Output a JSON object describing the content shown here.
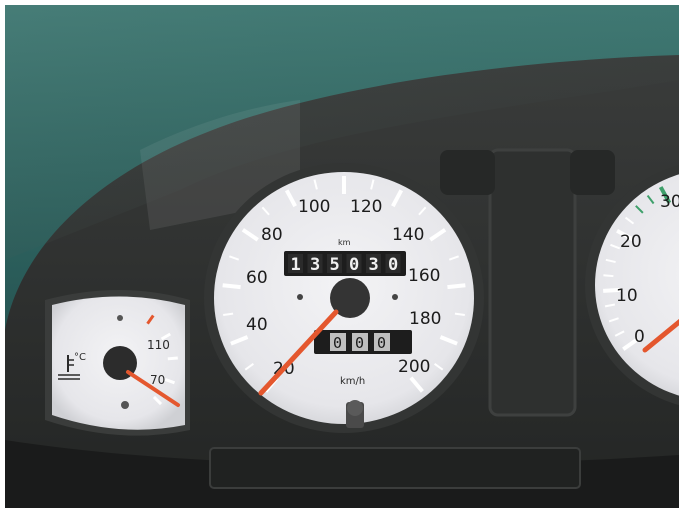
{
  "speedometer": {
    "tick_labels": [
      "20",
      "40",
      "60",
      "80",
      "100",
      "120",
      "140",
      "160",
      "180",
      "200"
    ],
    "unit_label": "km/h",
    "odometer_unit": "km",
    "odometer_digits": [
      "1",
      "3",
      "5",
      "0",
      "3",
      "0"
    ],
    "tripmeter_digits": [
      "0",
      "0",
      "0"
    ],
    "needle_value": 20
  },
  "temperature_gauge": {
    "tick_labels": [
      "70",
      "110"
    ],
    "unit_label": "°C",
    "needle_value": 70
  },
  "tachometer": {
    "tick_labels": [
      "0",
      "10",
      "20",
      "30"
    ],
    "needle_value": 0
  },
  "colors": {
    "dial_face": "#e9e9ec",
    "needle": "#e4572e",
    "dashboard": "#2a2c2b",
    "windshield_tint": "#2f6f6a"
  }
}
